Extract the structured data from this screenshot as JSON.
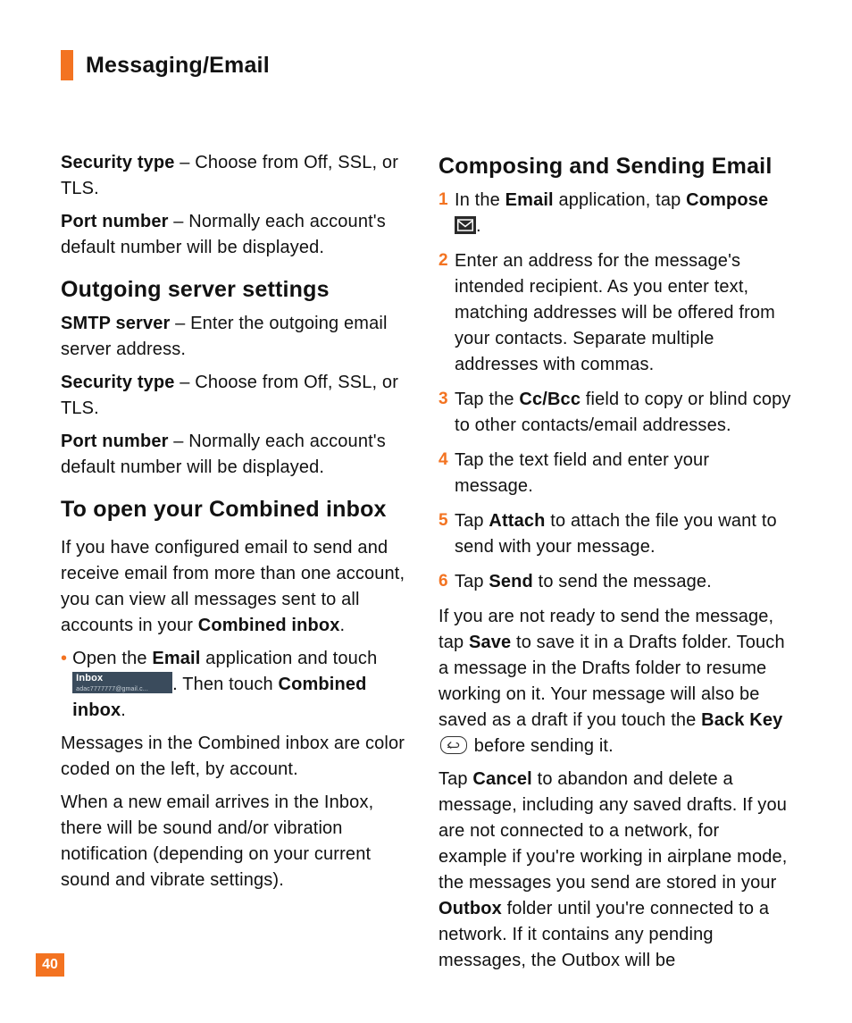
{
  "header": {
    "title": "Messaging/Email"
  },
  "left": {
    "p1_bold": "Security type",
    "p1_rest": " – Choose from Off, SSL, or TLS.",
    "p2_bold": "Port number",
    "p2_rest": " – Normally each account's default number will be displayed.",
    "h_outgoing": "Outgoing server settings",
    "p3_bold": "SMTP server",
    "p3_rest": " – Enter the outgoing email server address.",
    "p4_bold": "Security type",
    "p4_rest": " – Choose from Off, SSL, or TLS.",
    "p5_bold": "Port number",
    "p5_rest": " – Normally each account's default number will be displayed.",
    "h_combined": "To open your Combined inbox",
    "p6a": "If you have configured email to send and receive email from more than one account, you can view all messages sent to all accounts in your ",
    "p6b_bold": "Combined inbox",
    "p6c": ".",
    "bullet1_a": "Open the ",
    "bullet1_b_bold": "Email",
    "bullet1_c": " application and touch ",
    "bullet1_d": ". Then touch ",
    "bullet1_e_bold": "Combined inbox",
    "bullet1_f": ".",
    "inbox_chip_line1": "Inbox",
    "inbox_chip_line2": "adac7777777@gmail.c...",
    "p7": "Messages in the Combined inbox are color coded on the left, by account.",
    "p8": "When a new email arrives in the Inbox, there will be sound and/or vibration notification (depending on your current sound and vibrate settings)."
  },
  "right": {
    "h_compose": "Composing and Sending Email",
    "items": [
      {
        "n": "1",
        "a": "In the ",
        "b": "Email",
        "c": " application, tap ",
        "d": "Compose",
        "e": " ",
        "icon": "compose",
        "f": "."
      },
      {
        "n": "2",
        "text": "Enter an address for the message's intended recipient. As you enter text, matching addresses will be offered from your contacts. Separate multiple addresses with commas."
      },
      {
        "n": "3",
        "a": "Tap the ",
        "b": "Cc/Bcc",
        "c": " field to copy or blind copy to other contacts/email addresses."
      },
      {
        "n": "4",
        "text": "Tap the text field and enter your message."
      },
      {
        "n": "5",
        "a": "Tap ",
        "b": "Attach",
        "c": " to attach the file you want to send with your message."
      },
      {
        "n": "6",
        "a": "Tap ",
        "b": "Send",
        "c": " to send the message."
      }
    ],
    "p1_a": "If you are not ready to send the message, tap ",
    "p1_b": "Save",
    "p1_c": " to save it in a Drafts folder. Touch a message in the Drafts folder to resume working on it. Your message will also be saved as a draft if you touch the ",
    "p1_d": "Back Key",
    "p1_e": " ",
    "p1_f": " before sending it.",
    "p2_a": "Tap ",
    "p2_b": "Cancel",
    "p2_c": " to abandon and delete a message, including any saved drafts. If you are not connected to a network, for example if you're working in airplane mode, the messages you send are stored in your ",
    "p2_d": "Outbox",
    "p2_e": " folder until you're connected to a network. If it contains any pending messages, the Outbox will be"
  },
  "page_number": "40"
}
